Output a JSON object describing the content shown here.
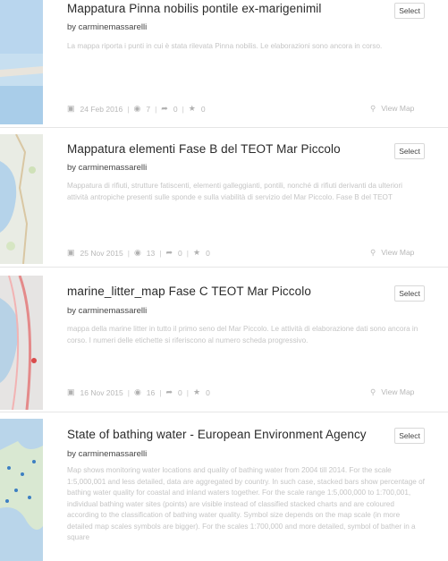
{
  "cards": [
    {
      "title": "Mappatura Pinna nobilis pontile ex-marigenimil",
      "select_label": "Select",
      "byline": "by carminemassarelli",
      "description": "La mappa riporta i punti in cui è stata rilevata Pinna nobilis. Le elaborazioni sono ancora in corso.",
      "date": "24 Feb 2016",
      "views": "7",
      "shares": "0",
      "stars": "0",
      "view_map_label": "View Map"
    },
    {
      "title": "Mappatura elementi Fase B del TEOT Mar Piccolo",
      "select_label": "Select",
      "byline": "by carminemassarelli",
      "description": "Mappatura di rifiuti, strutture fatiscenti, elementi galleggianti, pontili, nonché di rifiuti derivanti da ulteriori attività antropiche presenti sulle sponde e sulla viabilità di servizio del Mar Piccolo. Fase B del TEOT",
      "date": "25 Nov 2015",
      "views": "13",
      "shares": "0",
      "stars": "0",
      "view_map_label": "View Map"
    },
    {
      "title": "marine_litter_map Fase C TEOT Mar Piccolo",
      "select_label": "Select",
      "byline": "by carminemassarelli",
      "description": "mappa della marine litter in tutto il primo seno del Mar Piccolo. Le attività di elaborazione dati sono ancora in corso. I numeri delle etichette si riferiscono al numero scheda progressivo.",
      "date": "16 Nov 2015",
      "views": "16",
      "shares": "0",
      "stars": "0",
      "view_map_label": "View Map"
    },
    {
      "title": "State of bathing water - European Environment Agency",
      "select_label": "Select",
      "byline": "by carminemassarelli",
      "description": "Map shows monitoring water locations and quality of bathing water from 2004 till 2014. For the scale 1:5,000,001 and less detailed, data are aggregated by country. In such case, stacked bars show percentage of bathing water quality for coastal and inland waters together. For the scale range 1:5,000,000 to 1:700,001, individual bathing water sites (points) are visible instead of classified stacked charts and are coloured according to the classification of bathing water quality. Symbol size depends on the map scale (in more detailed map scales symbols are bigger). For the scales 1:700,000 and more detailed, symbol of bather in a square"
    }
  ]
}
